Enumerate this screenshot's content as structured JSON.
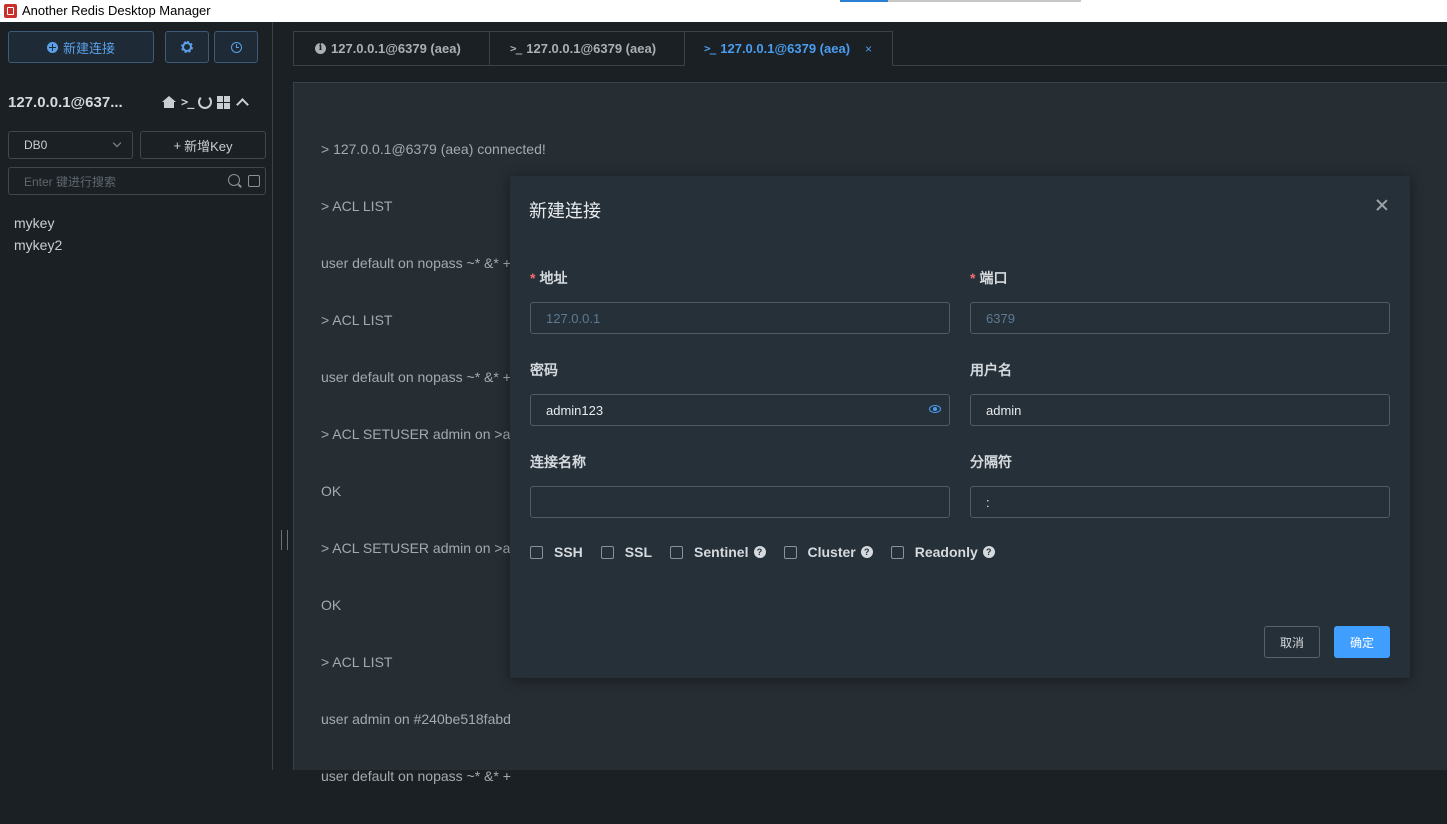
{
  "window": {
    "title": "Another Redis Desktop Manager"
  },
  "sidebar": {
    "new_connection_label": "新建连接",
    "connection_name": "127.0.0.1@637...",
    "db_select_value": "DB0",
    "add_key_label": "新增Key",
    "search_placeholder": "Enter 键进行搜索",
    "keys": [
      "mykey",
      "mykey2"
    ]
  },
  "tabs": [
    {
      "label": "127.0.0.1@6379 (aea)",
      "icon": "info-icon",
      "active": false
    },
    {
      "label": "127.0.0.1@6379 (aea)",
      "icon": "terminal-icon",
      "active": false
    },
    {
      "label": "127.0.0.1@6379 (aea)",
      "icon": "terminal-icon",
      "active": true
    }
  ],
  "console": {
    "lines": [
      "> 127.0.0.1@6379 (aea) connected!",
      "> ACL LIST",
      "user default on nopass ~* &* +@all",
      "> ACL LIST",
      "user default on nopass ~* &* +",
      "> ACL SETUSER admin on >adr",
      "OK",
      "> ACL SETUSER admin on >adr",
      "OK",
      "> ACL LIST",
      "user admin on #240be518fabd",
      "user default on nopass ~* &* +"
    ]
  },
  "modal": {
    "title": "新建连接",
    "host": {
      "label": "地址",
      "placeholder": "127.0.0.1",
      "value": ""
    },
    "port": {
      "label": "端口",
      "placeholder": "6379",
      "value": ""
    },
    "password": {
      "label": "密码",
      "value": "admin123"
    },
    "username": {
      "label": "用户名",
      "value": "admin"
    },
    "conn_name": {
      "label": "连接名称",
      "value": ""
    },
    "separator": {
      "label": "分隔符",
      "value": ":"
    },
    "options": [
      "SSH",
      "SSL",
      "Sentinel",
      "Cluster",
      "Readonly"
    ],
    "cancel_label": "取消",
    "ok_label": "确定"
  },
  "colors": {
    "accent": "#409eff",
    "required": "#f56c6c",
    "background": "#1b2024",
    "modal_bg": "#263038"
  }
}
